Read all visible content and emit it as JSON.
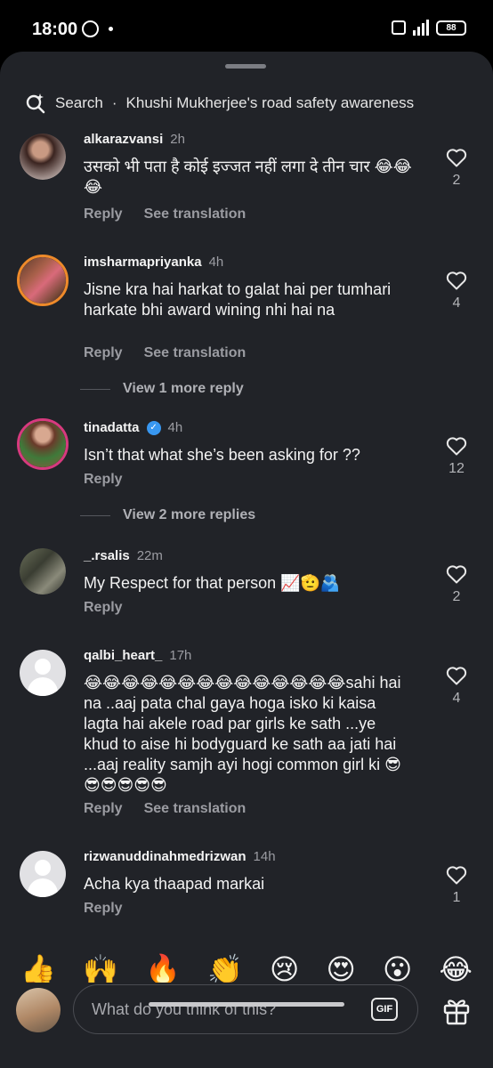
{
  "status_bar": {
    "time": "18:00",
    "battery": "88"
  },
  "search": {
    "prefix": "Search",
    "query": "Khushi Mukherjee's road safety awareness",
    "separator": "·"
  },
  "comments": [
    {
      "user": "alkarazvansi",
      "ago": "2h",
      "text": "उसको भी पता है कोई इज्जत नहीं लगा दे तीन चार 😂😂😂",
      "likes": "2",
      "reply": "Reply",
      "translate": "See translation"
    },
    {
      "user": "imsharmapriyanka",
      "ago": "4h",
      "text": "Jisne kra hai harkat to galat hai per tumhari harkate bhi award wining nhi hai na",
      "likes": "4",
      "reply": "Reply",
      "translate": "See translation",
      "more": "View 1 more reply"
    },
    {
      "user": "tinadatta",
      "ago": "4h",
      "text": "Isn’t that what she’s been asking for ??",
      "likes": "12",
      "reply": "Reply",
      "more": "View 2 more replies"
    },
    {
      "user": "_.rsalis",
      "ago": "22m",
      "text": "My Respect for that person 📈🫡🫂",
      "likes": "2",
      "reply": "Reply"
    },
    {
      "user": "qalbi_heart_",
      "ago": "17h",
      "text": "😂😂😂😂😂😂😂😂😂😂😂😂😂😂sahi hai na ..aaj pata chal gaya hoga isko ki kaisa lagta hai akele road par girls ke sath ...ye khud to aise hi bodyguard ke sath aa jati hai ...aaj reality samjh ayi hogi common girl ki 😎😎😎😎😎😎",
      "likes": "4",
      "reply": "Reply",
      "translate": "See translation"
    },
    {
      "user": "rizwanuddinahmedrizwan",
      "ago": "14h",
      "text": "Acha kya thaapad markai",
      "likes": "1",
      "reply": "Reply"
    }
  ],
  "quick_emojis": [
    "👍",
    "🙌",
    "🔥",
    "👏",
    "😢",
    "😍",
    "😮",
    "😂"
  ],
  "composer": {
    "placeholder": "What do you think of this?",
    "gif_label": "GIF"
  },
  "icons": {
    "search": "search-sparkle-icon",
    "like": "heart-outline-icon",
    "gift": "gift-icon",
    "verified": "verified-badge-icon"
  },
  "colors": {
    "sheet": "#212328",
    "ring_story": "#ee8a2a",
    "verified": "#3897f0"
  }
}
